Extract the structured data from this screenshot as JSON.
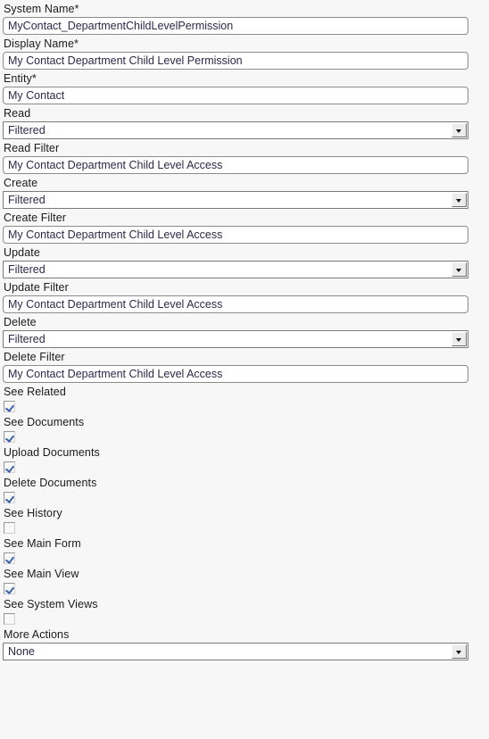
{
  "form": {
    "fields": [
      {
        "kind": "text",
        "name": "system-name",
        "label": "System Name*",
        "value": "MyContact_DepartmentChildLevelPermission"
      },
      {
        "kind": "text",
        "name": "display-name",
        "label": "Display Name*",
        "value": "My Contact Department Child Level Permission"
      },
      {
        "kind": "text",
        "name": "entity",
        "label": "Entity*",
        "value": "My Contact"
      },
      {
        "kind": "select",
        "name": "read",
        "label": "Read",
        "value": "Filtered"
      },
      {
        "kind": "text",
        "name": "read-filter",
        "label": "Read Filter",
        "value": "My Contact Department Child Level Access"
      },
      {
        "kind": "select",
        "name": "create",
        "label": "Create",
        "value": "Filtered"
      },
      {
        "kind": "text",
        "name": "create-filter",
        "label": "Create Filter",
        "value": "My Contact Department Child Level Access"
      },
      {
        "kind": "select",
        "name": "update",
        "label": "Update",
        "value": "Filtered"
      },
      {
        "kind": "text",
        "name": "update-filter",
        "label": "Update Filter",
        "value": "My Contact Department Child Level Access"
      },
      {
        "kind": "select",
        "name": "delete",
        "label": "Delete",
        "value": "Filtered"
      },
      {
        "kind": "text",
        "name": "delete-filter",
        "label": "Delete Filter",
        "value": "My Contact Department Child Level Access"
      },
      {
        "kind": "checkbox",
        "name": "see-related",
        "label": "See Related",
        "checked": true
      },
      {
        "kind": "checkbox",
        "name": "see-documents",
        "label": "See Documents",
        "checked": true
      },
      {
        "kind": "checkbox",
        "name": "upload-documents",
        "label": "Upload Documents",
        "checked": true
      },
      {
        "kind": "checkbox",
        "name": "delete-documents",
        "label": "Delete Documents",
        "checked": true
      },
      {
        "kind": "checkbox",
        "name": "see-history",
        "label": "See History",
        "checked": false
      },
      {
        "kind": "checkbox",
        "name": "see-main-form",
        "label": "See Main Form",
        "checked": true
      },
      {
        "kind": "checkbox",
        "name": "see-main-view",
        "label": "See Main View",
        "checked": true
      },
      {
        "kind": "checkbox",
        "name": "see-system-views",
        "label": "See System Views",
        "checked": false
      },
      {
        "kind": "select",
        "name": "more-actions",
        "label": "More Actions",
        "value": "None"
      }
    ]
  },
  "icons": {
    "dropdown_arrow": "chevron-down-icon",
    "checkmark": "check-icon"
  },
  "colors": {
    "page_background": "#f7f7f7",
    "input_background": "#ffffff",
    "label_text": "#1a1a1a",
    "value_text": "#2a2a4a",
    "checkmark": "#3a5fa8",
    "input_border": "#8c8c8c"
  }
}
